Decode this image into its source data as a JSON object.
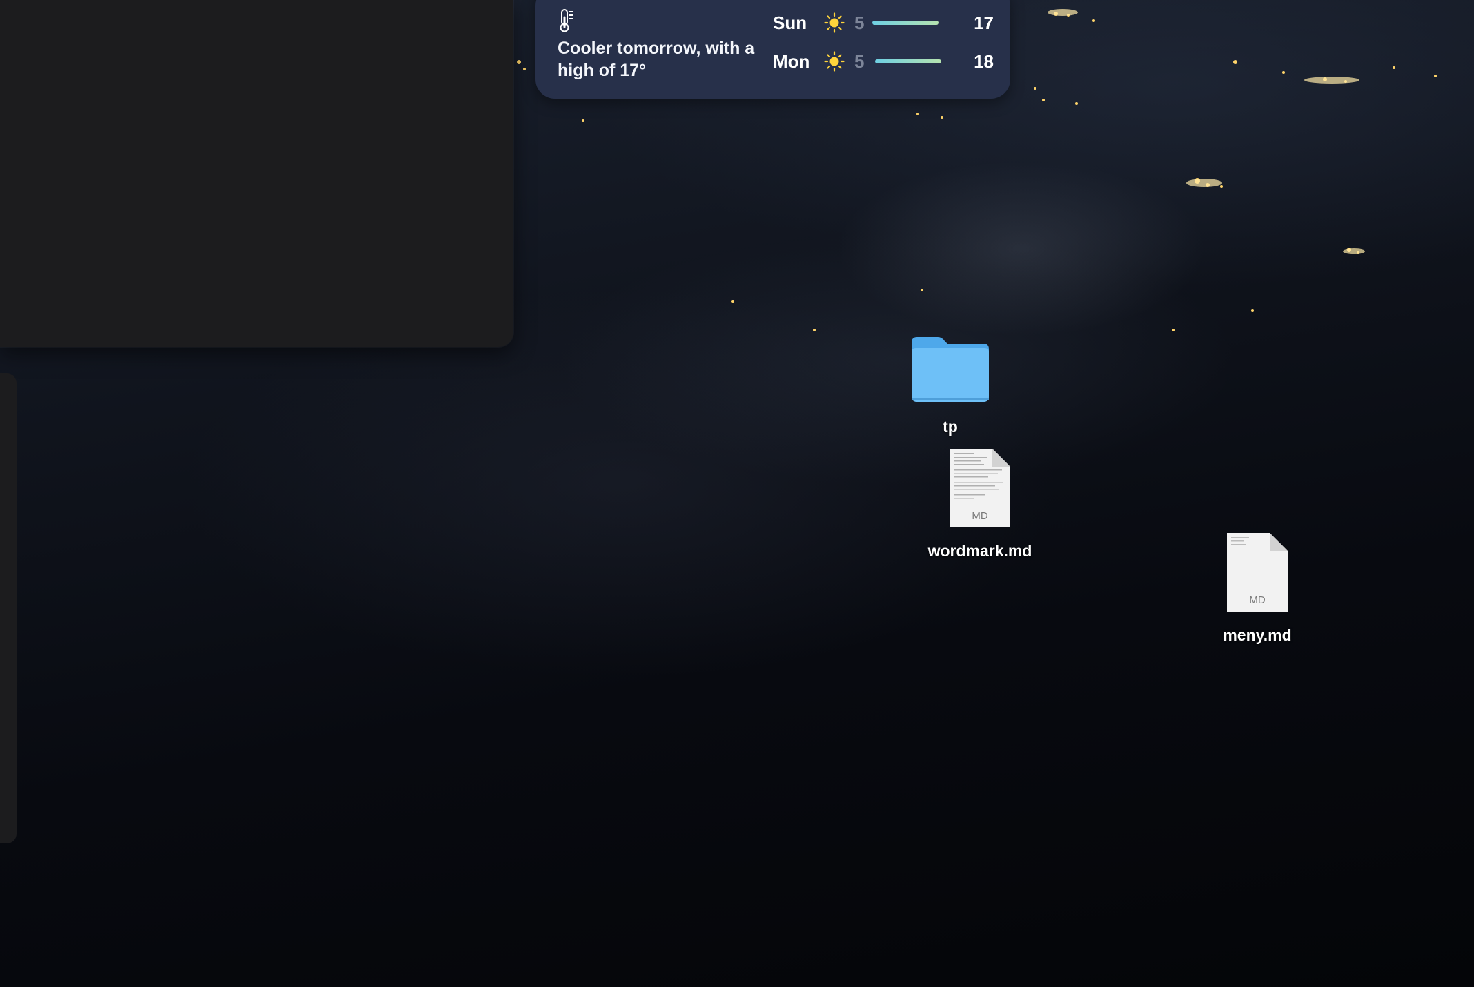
{
  "weather": {
    "summary": "Cooler tomorrow, with a high of 17°",
    "icon": "thermometer-icon",
    "forecast": [
      {
        "day": "Sun",
        "icon": "sun-icon",
        "low": "5",
        "high": "17"
      },
      {
        "day": "Mon",
        "icon": "sun-icon",
        "low": "5",
        "high": "18"
      }
    ]
  },
  "desktop_items": [
    {
      "name": "tp",
      "kind": "folder",
      "icon": "folder-icon"
    },
    {
      "name": "wordmark.md",
      "kind": "markdown",
      "icon": "document-icon",
      "badge": "MD"
    },
    {
      "name": "meny.md",
      "kind": "markdown",
      "icon": "document-icon",
      "badge": "MD"
    }
  ],
  "colors": {
    "widget_bg": "#27304a",
    "folder_blue": "#6ec0f7",
    "window_bg": "#1c1c1e"
  }
}
